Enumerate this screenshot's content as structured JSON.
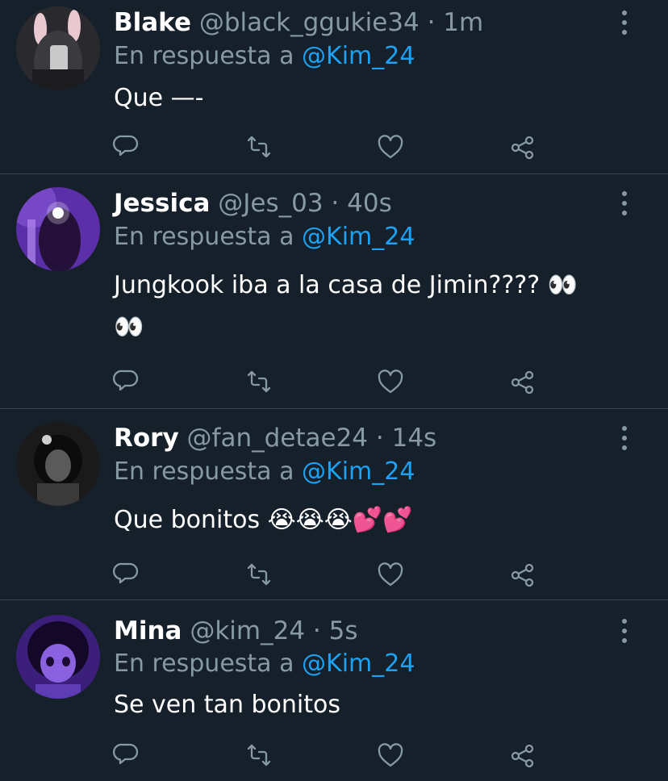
{
  "tweets": [
    {
      "name": "Blake",
      "handle": "@black_ggukie34",
      "separator": "·",
      "time": "1m",
      "reply_prefix": "En respuesta a",
      "reply_to": "@Kim_24",
      "text": "Que —-"
    },
    {
      "name": "Jessica",
      "handle": "@Jes_03",
      "separator": "·",
      "time": "40s",
      "reply_prefix": "En respuesta a",
      "reply_to": "@Kim_24",
      "text": "Jungkook iba a la casa de Jimin???? 👀 👀"
    },
    {
      "name": "Rory",
      "handle": "@fan_detae24",
      "separator": "·",
      "time": "14s",
      "reply_prefix": "En respuesta a",
      "reply_to": "@Kim_24",
      "text": "Que bonitos 😭😭😭💕💕"
    },
    {
      "name": "Mina",
      "handle": "@kim_24",
      "separator": "·",
      "time": "5s",
      "reply_prefix": "En respuesta a",
      "reply_to": "@Kim_24",
      "text": "Se ven tan bonitos"
    }
  ],
  "icons": {
    "reply": "reply-icon",
    "retweet": "retweet-icon",
    "like": "like-icon",
    "share": "share-icon",
    "more": "more-vertical-icon"
  },
  "colors": {
    "background": "#15202b",
    "secondary_text": "#8899a6",
    "mention": "#1da1f2",
    "divider": "#38444d"
  }
}
